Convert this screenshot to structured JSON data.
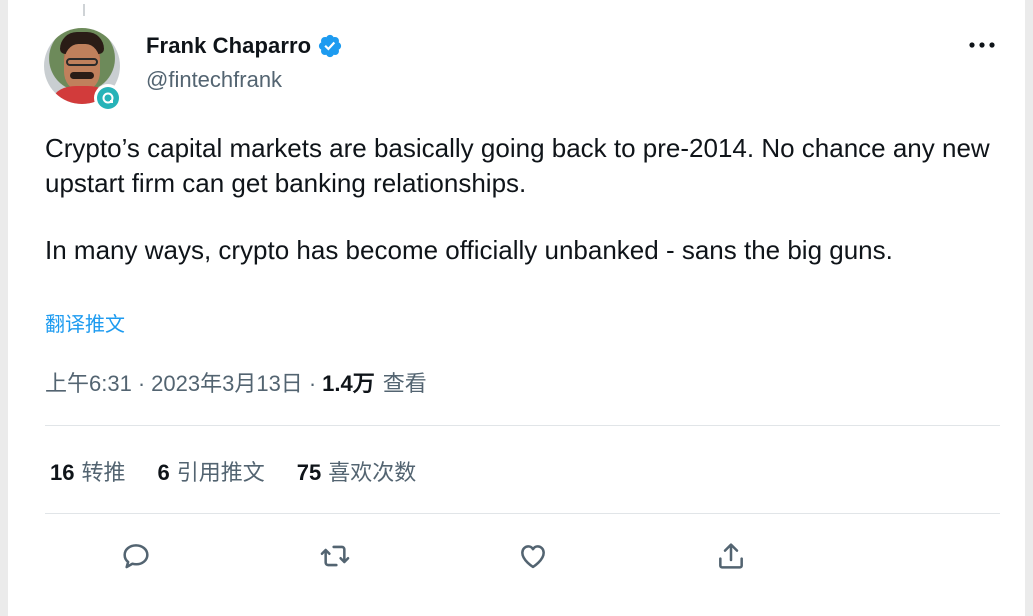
{
  "author": {
    "name": "Frank Chaparro",
    "handle": "@fintechfrank",
    "verified": true
  },
  "tweet": {
    "paragraphs": [
      "Crypto’s capital markets are basically going back to pre-2014. No chance any new upstart firm can get banking relationships.",
      "In many ways, crypto has become officially unbanked - sans the big guns."
    ],
    "translate_label": "翻译推文"
  },
  "meta": {
    "time": "上午6:31",
    "separator": "·",
    "date": "2023年3月13日",
    "views_count": "1.4万",
    "views_label": "查看"
  },
  "stats": {
    "retweets": {
      "count": "16",
      "label": "转推"
    },
    "quotes": {
      "count": "6",
      "label": "引用推文"
    },
    "likes": {
      "count": "75",
      "label": "喜欢次数"
    }
  },
  "icons": {
    "more": "more-horizontal-icon",
    "reply": "reply-icon",
    "retweet": "retweet-icon",
    "like": "heart-icon",
    "share": "share-icon",
    "verified": "verified-badge-icon"
  },
  "colors": {
    "accent": "#1d9bf0",
    "text": "#0f1419",
    "secondary": "#536471"
  }
}
